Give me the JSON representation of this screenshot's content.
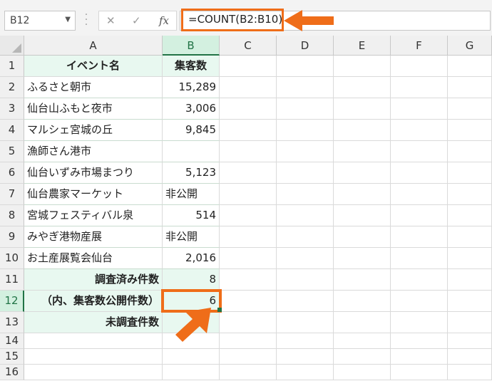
{
  "name_box": {
    "value": "B12"
  },
  "formula_bar": {
    "cancel_icon": "✕",
    "enter_icon": "✓",
    "fx_label": "fx",
    "formula": "=COUNT(B2:B10)"
  },
  "columns": [
    "A",
    "B",
    "C",
    "D",
    "E",
    "F",
    "G"
  ],
  "selected_column": "B",
  "selected_row": 12,
  "rows": [
    {
      "num": "1",
      "a": "イベント名",
      "b": "集客数"
    },
    {
      "num": "2",
      "a": "ふるさと朝市",
      "b": "15,289"
    },
    {
      "num": "3",
      "a": "仙台山ふもと夜市",
      "b": "3,006"
    },
    {
      "num": "4",
      "a": "マルシェ宮城の丘",
      "b": "9,845"
    },
    {
      "num": "5",
      "a": "漁師さん港市",
      "b": ""
    },
    {
      "num": "6",
      "a": "仙台いずみ市場まつり",
      "b": "5,123"
    },
    {
      "num": "7",
      "a": "仙台農家マーケット",
      "b": "非公開"
    },
    {
      "num": "8",
      "a": "宮城フェスティバル泉",
      "b": "514"
    },
    {
      "num": "9",
      "a": "みやぎ港物産展",
      "b": "非公開"
    },
    {
      "num": "10",
      "a": "お土産展覧会仙台",
      "b": "2,016"
    },
    {
      "num": "11",
      "a": "調査済み件数",
      "b": "8"
    },
    {
      "num": "12",
      "a": "（内、集客数公開件数）",
      "b": "6"
    },
    {
      "num": "13",
      "a": "未調査件数",
      "b": ""
    },
    {
      "num": "14",
      "a": "",
      "b": ""
    },
    {
      "num": "15",
      "a": "",
      "b": ""
    },
    {
      "num": "16",
      "a": "",
      "b": ""
    }
  ],
  "colors": {
    "accent": "#ef6d19",
    "table_tint": "#e8f8f0",
    "excel_green": "#217346"
  }
}
